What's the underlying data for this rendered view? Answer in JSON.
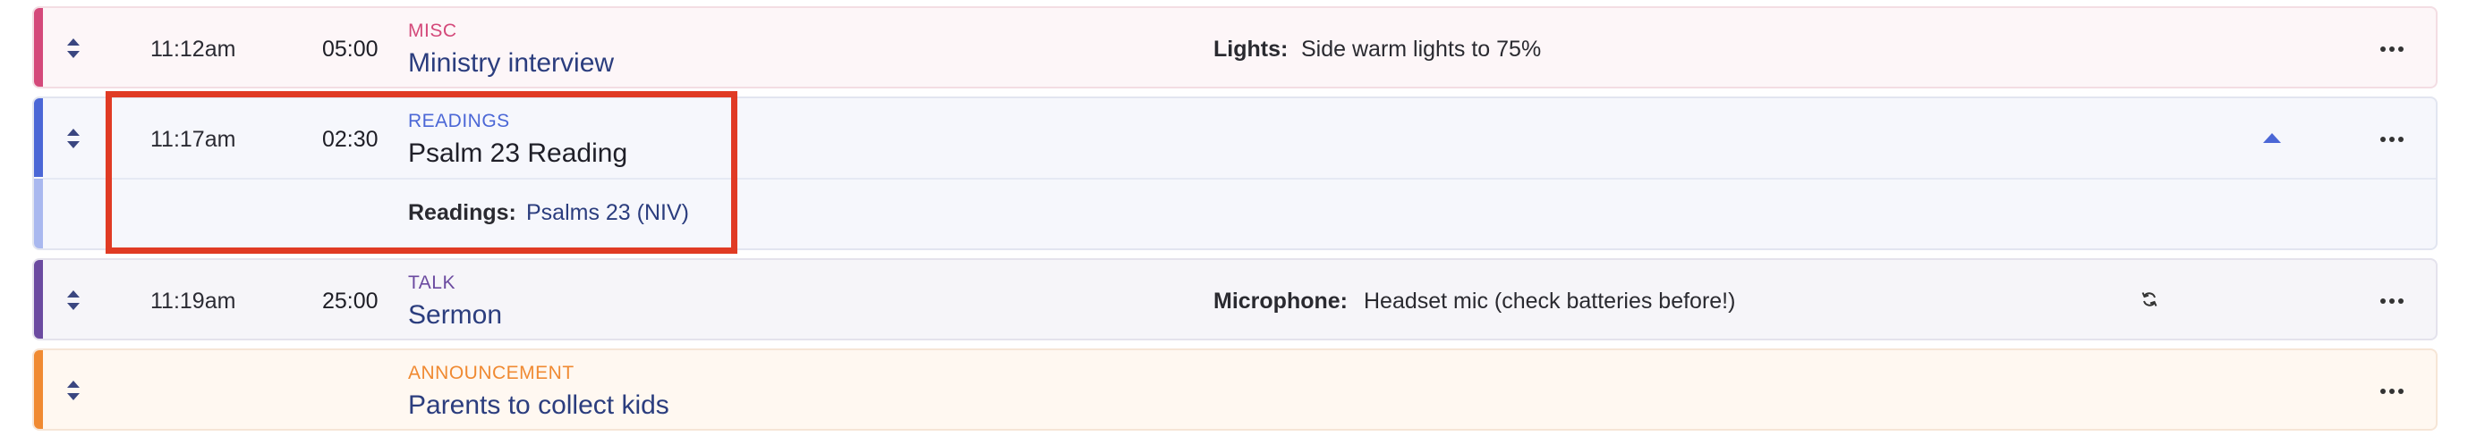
{
  "items": [
    {
      "category": "MISC",
      "category_color": "#d4497a",
      "time": "11:12am",
      "duration": "05:00",
      "title": "Ministry interview",
      "field_label": "Lights:",
      "field_value": "Side warm lights to 75%"
    },
    {
      "category": "READINGS",
      "category_color": "#4b67d6",
      "time": "11:17am",
      "duration": "02:30",
      "title": "Psalm 23 Reading",
      "expanded": true,
      "detail_label": "Readings:",
      "detail_value": "Psalms 23 (NIV)"
    },
    {
      "category": "TALK",
      "category_color": "#6b4aa0",
      "time": "11:19am",
      "duration": "25:00",
      "title": "Sermon",
      "field_label": "Microphone:",
      "field_value": "Headset mic (check batteries before!)"
    },
    {
      "category": "ANNOUNCEMENT",
      "category_color": "#f08a32",
      "time": "",
      "duration": "",
      "title": "Parents to collect kids"
    }
  ],
  "icons": {
    "drag": "drag-handle-icon",
    "menu": "more-horizontal-icon",
    "collapse": "caret-up-icon",
    "sync": "sync-icon"
  },
  "highlight_color": "#e03b24"
}
